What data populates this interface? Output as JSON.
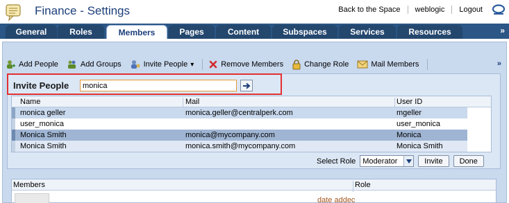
{
  "header": {
    "title": "Finance - Settings",
    "links": [
      "Back to the Space",
      "weblogic",
      "Logout"
    ]
  },
  "tabs": [
    {
      "label": "General",
      "active": false
    },
    {
      "label": "Roles",
      "active": false
    },
    {
      "label": "Members",
      "active": true
    },
    {
      "label": "Pages",
      "active": false
    },
    {
      "label": "Content",
      "active": false
    },
    {
      "label": "Subspaces",
      "active": false
    },
    {
      "label": "Services",
      "active": false
    },
    {
      "label": "Resources",
      "active": false
    }
  ],
  "tabs_more": "»",
  "toolbar": {
    "items": [
      {
        "label": "Add People",
        "icon": "add-people-icon"
      },
      {
        "label": "Add Groups",
        "icon": "add-groups-icon"
      },
      {
        "label": "Invite People",
        "icon": "invite-people-icon",
        "dropdown": "▾"
      },
      {
        "label": "Remove Members",
        "icon": "remove-icon"
      },
      {
        "label": "Change Role",
        "icon": "lock-icon"
      },
      {
        "label": "Mail Members",
        "icon": "mail-icon"
      }
    ],
    "more": "»"
  },
  "invite": {
    "label": "Invite People",
    "search_value": "monica"
  },
  "results": {
    "columns": [
      "Name",
      "Mail",
      "User ID"
    ],
    "rows": [
      {
        "name": "monica geller",
        "mail": "monica.geller@centralperk.com",
        "user_id": "mgeller",
        "state": "selected-light"
      },
      {
        "name": "user_monica",
        "mail": "",
        "user_id": "user_monica",
        "state": "normal"
      },
      {
        "name": "Monica Smith",
        "mail": "monica@mycompany.com",
        "user_id": "Monica",
        "state": "selected-dark"
      },
      {
        "name": "Monica Smith",
        "mail": "monica.smith@mycompany.com",
        "user_id": "Monica Smith",
        "state": "normal"
      }
    ],
    "select_role_label": "Select Role",
    "role_value": "Moderator",
    "invite_button": "Invite",
    "done_button": "Done"
  },
  "members": {
    "columns": [
      "Members",
      "Role"
    ],
    "date_added": "date addec"
  },
  "colors": {
    "title": "#1c3f7a",
    "tab_bar": "#2b5685",
    "highlight_border": "#e23030",
    "selected_light": "#c9d9ee",
    "selected_dark": "#9fb5d3"
  }
}
